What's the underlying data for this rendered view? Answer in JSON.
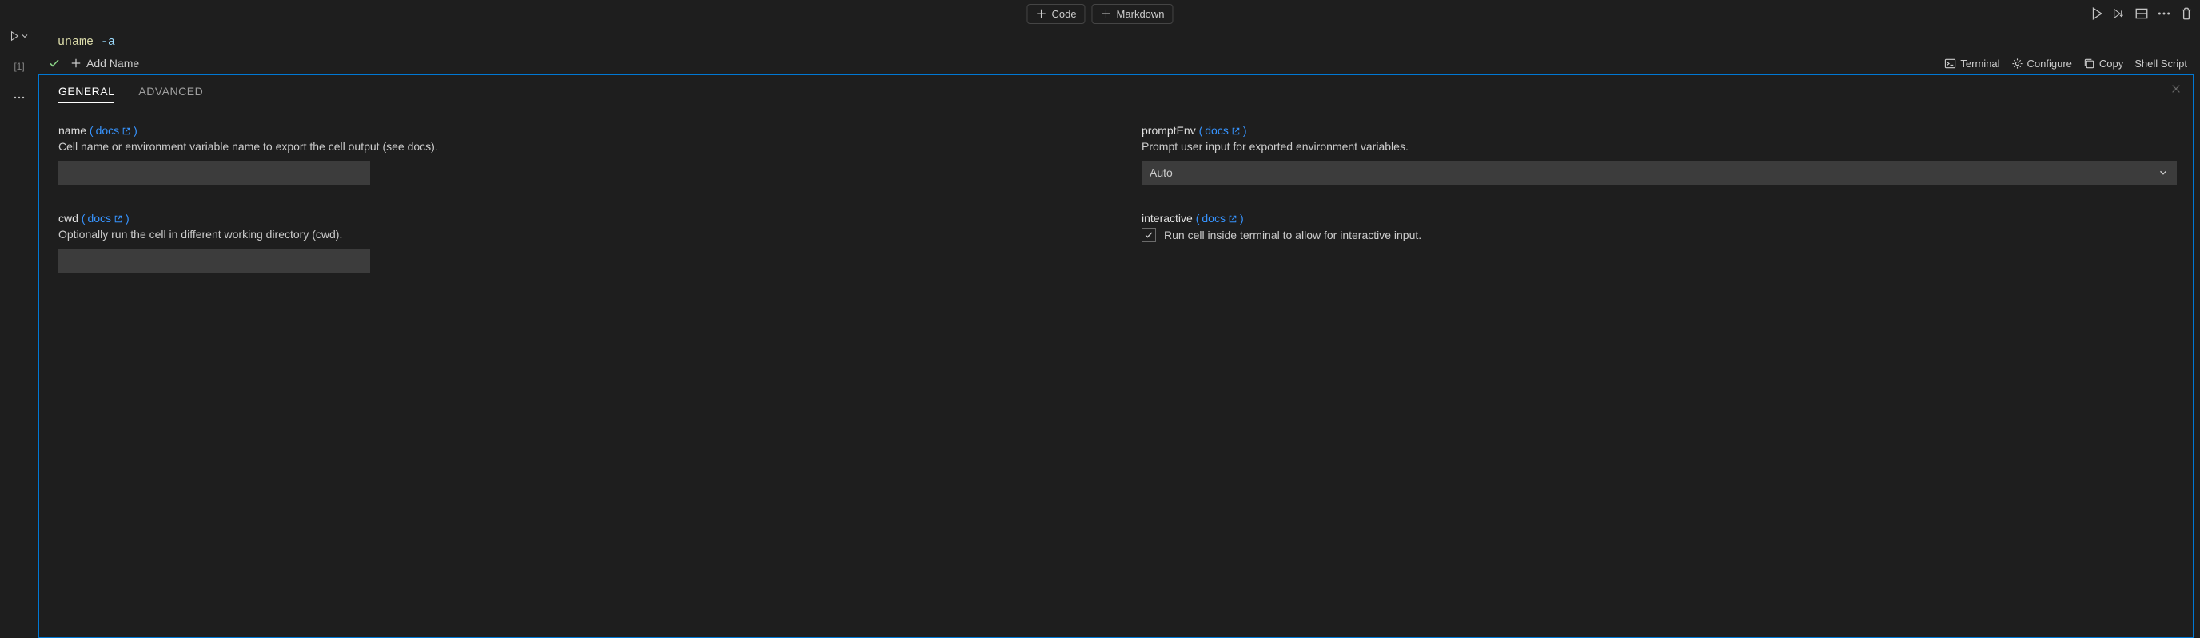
{
  "toolbar": {
    "code_label": "Code",
    "markdown_label": "Markdown"
  },
  "gutter": {
    "exec_count": "[1]"
  },
  "cell": {
    "code_cmd": "uname",
    "code_flag_prefix": " -",
    "code_flag_value": "a",
    "add_name_label": "Add Name"
  },
  "status": {
    "terminal": "Terminal",
    "configure": "Configure",
    "copy": "Copy",
    "language": "Shell Script"
  },
  "panel": {
    "tabs": {
      "general": "GENERAL",
      "advanced": "ADVANCED"
    },
    "fields": {
      "name": {
        "label": "name",
        "docs": "docs",
        "desc": "Cell name or environment variable name to export the cell output (see docs).",
        "value": ""
      },
      "cwd": {
        "label": "cwd",
        "docs": "docs",
        "desc": "Optionally run the cell in different working directory (cwd).",
        "value": ""
      },
      "promptEnv": {
        "label": "promptEnv",
        "docs": "docs",
        "desc": "Prompt user input for exported environment variables.",
        "selected": "Auto"
      },
      "interactive": {
        "label": "interactive",
        "docs": "docs",
        "checkbox_label": "Run cell inside terminal to allow for interactive input.",
        "checked": true
      }
    }
  }
}
